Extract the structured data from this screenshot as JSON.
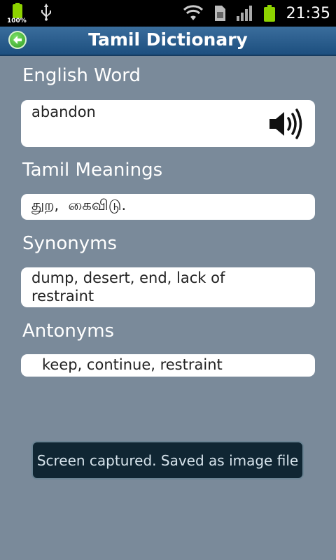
{
  "status_bar": {
    "battery_percent_label": "100%",
    "time": "21:35",
    "icons": [
      "battery-icon",
      "usb-icon",
      "wifi-icon",
      "sim-icon",
      "signal-icon",
      "battery-icon"
    ]
  },
  "header": {
    "title": "Tamil Dictionary",
    "back_icon": "back-arrow-icon"
  },
  "english_word": {
    "label": "English Word",
    "value": "abandon",
    "speaker_icon": "speaker-icon"
  },
  "tamil_meanings": {
    "label": "Tamil Meanings",
    "value": "துற,  கைவிடு."
  },
  "synonyms": {
    "label": "Synonyms",
    "value_line1": "dump, desert, end, lack of",
    "value_line2": "restraint"
  },
  "antonyms": {
    "label": "Antonyms",
    "value": "keep, continue, restraint"
  },
  "toast": {
    "message": "Screen captured. Saved as image file"
  },
  "colors": {
    "background": "#7a8a9a",
    "title_bar": "#1d4f7f",
    "battery_green": "#8ed300",
    "toast_bg": "#102633"
  }
}
